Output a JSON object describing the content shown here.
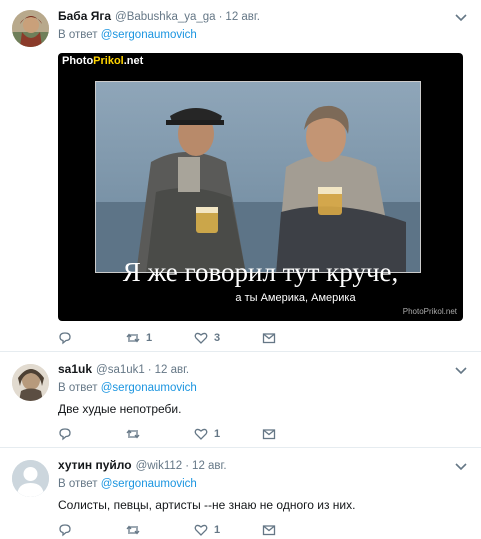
{
  "tweets": [
    {
      "name": "Баба Яга",
      "handle": "@Babushka_ya_ga",
      "date": "12 авг.",
      "reply_prefix": "В ответ",
      "reply_to": "@sergonaumovich",
      "media": {
        "watermark_top": "PhotoPrikol.net",
        "watermark_top_a": "Photo",
        "watermark_top_b": "Prikol",
        "watermark_top_c": ".net",
        "caption_main": "Я же говорил тут круче,",
        "caption_sub": "а ты Америка, Америка",
        "watermark_bottom": "PhotoPrikol.net"
      },
      "counts": {
        "reply": "",
        "retweet": "1",
        "like": "3"
      }
    },
    {
      "name": "sa1uk",
      "handle": "@sa1uk1",
      "date": "12 авг.",
      "reply_prefix": "В ответ",
      "reply_to": "@sergonaumovich",
      "text": "Две худые непотреби.",
      "counts": {
        "reply": "",
        "retweet": "",
        "like": "1"
      }
    },
    {
      "name": "хутин пуйло",
      "handle": "@wik112",
      "date": "12 авг.",
      "reply_prefix": "В ответ",
      "reply_to": "@sergonaumovich",
      "text": "Солисты, певцы, артисты --не знаю не одного из них.",
      "counts": {
        "reply": "",
        "retweet": "",
        "like": "1"
      }
    }
  ],
  "separator": "·",
  "colors": {
    "link": "#1b95e0",
    "muted": "#657786",
    "text": "#14171a",
    "divider": "#e6ecf0"
  },
  "icons": [
    "reply-icon",
    "retweet-icon",
    "like-icon",
    "dm-icon",
    "chevron-down-icon"
  ]
}
